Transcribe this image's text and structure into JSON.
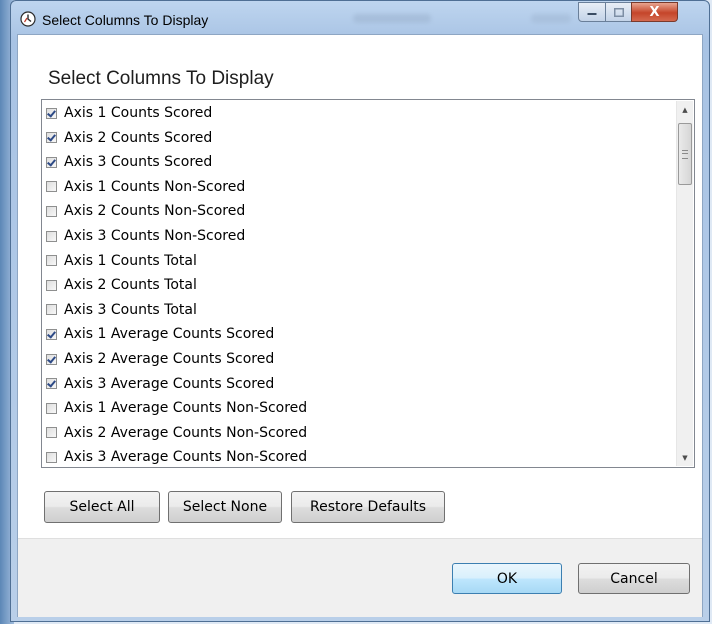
{
  "window": {
    "title": "Select Columns To Display",
    "icon": "app-clock-icon"
  },
  "caption_buttons": {
    "minimize": "minimize-icon",
    "maximize": "maximize-icon",
    "close": "close-icon",
    "close_glyph": "X"
  },
  "dialog": {
    "heading": "Select Columns To Display"
  },
  "columns": [
    {
      "label": "Axis 1 Counts Scored",
      "checked": true
    },
    {
      "label": "Axis 2 Counts Scored",
      "checked": true
    },
    {
      "label": "Axis 3 Counts Scored",
      "checked": true
    },
    {
      "label": "Axis 1 Counts Non-Scored",
      "checked": false
    },
    {
      "label": "Axis 2 Counts Non-Scored",
      "checked": false
    },
    {
      "label": "Axis 3 Counts Non-Scored",
      "checked": false
    },
    {
      "label": "Axis 1 Counts Total",
      "checked": false
    },
    {
      "label": "Axis 2 Counts Total",
      "checked": false
    },
    {
      "label": "Axis 3 Counts Total",
      "checked": false
    },
    {
      "label": "Axis 1 Average Counts Scored",
      "checked": true
    },
    {
      "label": "Axis 2 Average Counts Scored",
      "checked": true
    },
    {
      "label": "Axis 3 Average Counts Scored",
      "checked": true
    },
    {
      "label": "Axis 1 Average Counts Non-Scored",
      "checked": false
    },
    {
      "label": "Axis 2 Average Counts Non-Scored",
      "checked": false
    },
    {
      "label": "Axis 3 Average Counts Non-Scored",
      "checked": false
    }
  ],
  "actions": {
    "select_all": "Select All",
    "select_none": "Select None",
    "restore_defaults": "Restore Defaults"
  },
  "footer": {
    "ok": "OK",
    "cancel": "Cancel"
  },
  "colors": {
    "accent": "#3c7fb1",
    "check": "#2d4a86",
    "close_button": "#c5452a"
  }
}
